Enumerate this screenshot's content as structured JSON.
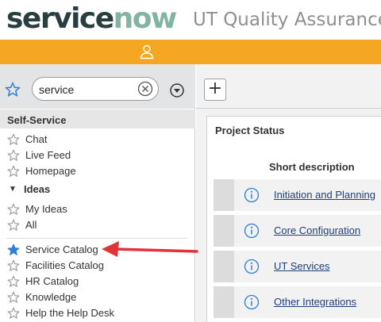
{
  "header": {
    "logo_main": "service",
    "logo_accent": "now",
    "instance_name": "UT Quality Assurance"
  },
  "topbar": {
    "user_icon": "user-icon",
    "accent_color": "#f5a623"
  },
  "navigator": {
    "search_value": "service",
    "section_title": "Self-Service",
    "items": [
      {
        "label": "Chat",
        "favorite": false
      },
      {
        "label": "Live Feed",
        "favorite": false
      },
      {
        "label": "Homepage",
        "favorite": false
      }
    ],
    "subgroup": {
      "label": "Ideas",
      "items": [
        {
          "label": "My Ideas",
          "favorite": false
        },
        {
          "label": "All",
          "favorite": false
        }
      ]
    },
    "items_after": [
      {
        "label": "Service Catalog",
        "favorite": true
      },
      {
        "label": "Facilities Catalog",
        "favorite": false
      },
      {
        "label": "HR Catalog",
        "favorite": false
      },
      {
        "label": "Knowledge",
        "favorite": false
      },
      {
        "label": "Help the Help Desk",
        "favorite": false
      }
    ],
    "favorite_color": "#2e7fd8",
    "annotation_arrow_color": "#e0333a"
  },
  "main": {
    "add_label": "+",
    "widget": {
      "title": "Project Status",
      "column_header": "Short description",
      "rows": [
        {
          "description": "Initiation and Planning"
        },
        {
          "description": "Core Configuration"
        },
        {
          "description": "UT Services"
        },
        {
          "description": "Other Integrations"
        }
      ]
    }
  }
}
